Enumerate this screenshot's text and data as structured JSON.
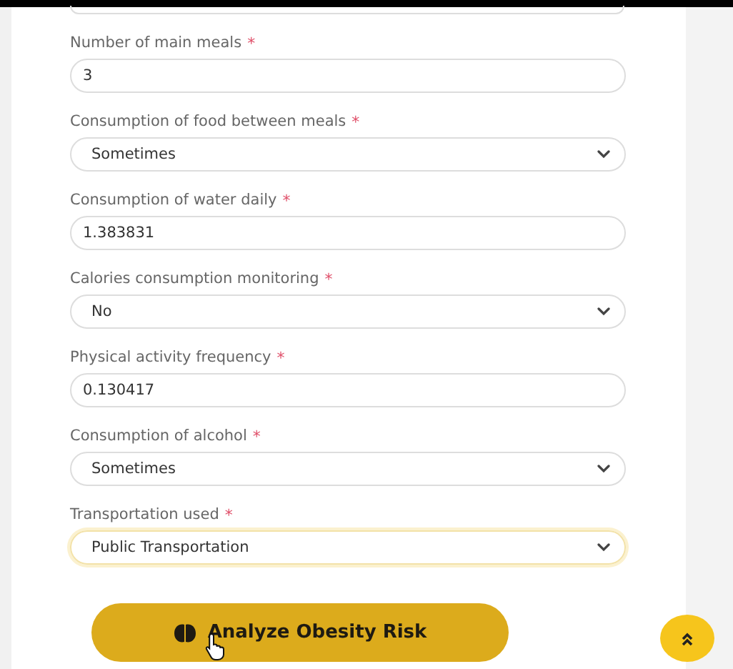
{
  "fields": [
    {
      "label": "Number of main meals",
      "required_mark": "*",
      "kind": "input",
      "value": "3",
      "focused": false
    },
    {
      "label": "Consumption of food between meals",
      "required_mark": "*",
      "kind": "select",
      "value": "Sometimes",
      "focused": false
    },
    {
      "label": "Consumption of water daily",
      "required_mark": "*",
      "kind": "input",
      "value": "1.383831",
      "focused": false
    },
    {
      "label": "Calories consumption monitoring",
      "required_mark": "*",
      "kind": "select",
      "value": "No",
      "focused": false
    },
    {
      "label": "Physical activity frequency",
      "required_mark": "*",
      "kind": "input",
      "value": "0.130417",
      "focused": false
    },
    {
      "label": "Consumption of alcohol",
      "required_mark": "*",
      "kind": "select",
      "value": "Sometimes",
      "focused": false
    },
    {
      "label": "Transportation used",
      "required_mark": "*",
      "kind": "select",
      "value": "Public Transportation",
      "focused": true
    }
  ],
  "submit_button": {
    "label": "Analyze Obesity Risk"
  }
}
